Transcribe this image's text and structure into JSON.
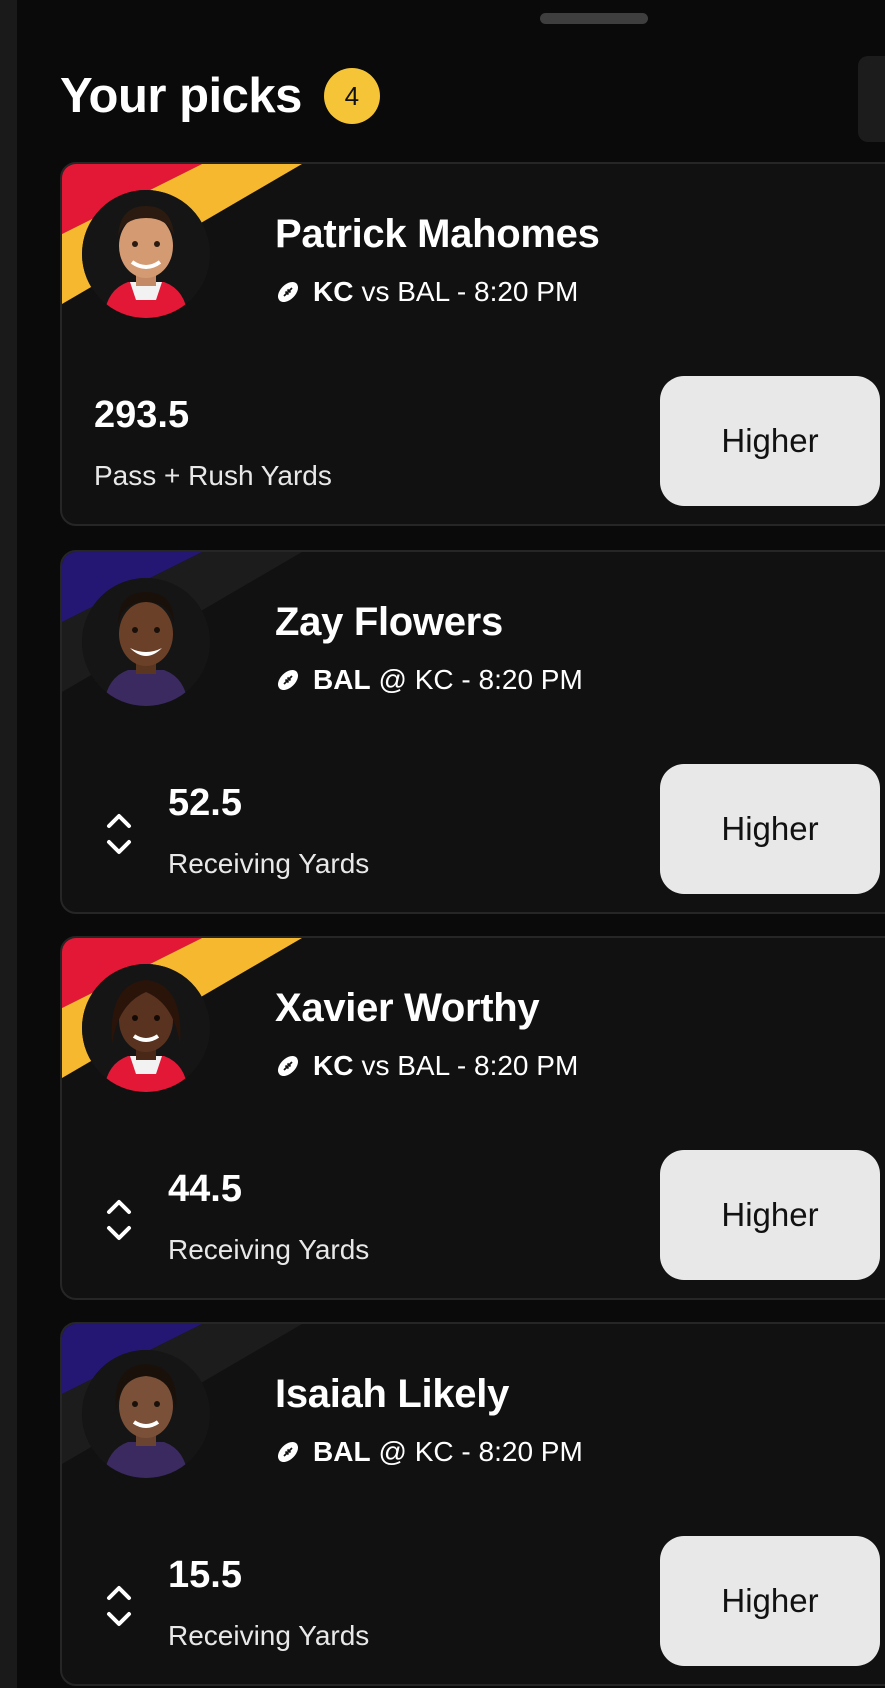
{
  "header": {
    "title": "Your picks",
    "pick_count": "4"
  },
  "picks": [
    {
      "player": "Patrick Mahomes",
      "team": "KC",
      "matchup_rest": "vs BAL - 8:20 PM",
      "line": "293.5",
      "stat": "Pass + Rush Yards",
      "button_label": "Higher",
      "team_colors": [
        "#e31837",
        "#f5b82e"
      ]
    },
    {
      "player": "Zay Flowers",
      "team": "BAL",
      "matchup_rest": "@ KC - 8:20 PM",
      "line": "52.5",
      "stat": "Receiving Yards",
      "button_label": "Higher",
      "team_colors": [
        "#241773",
        "#1a1a1a"
      ]
    },
    {
      "player": "Xavier Worthy",
      "team": "KC",
      "matchup_rest": "vs BAL - 8:20 PM",
      "line": "44.5",
      "stat": "Receiving Yards",
      "button_label": "Higher",
      "team_colors": [
        "#e31837",
        "#f5b82e"
      ]
    },
    {
      "player": "Isaiah Likely",
      "team": "BAL",
      "matchup_rest": "@ KC - 8:20 PM",
      "line": "15.5",
      "stat": "Receiving Yards",
      "button_label": "Higher",
      "team_colors": [
        "#241773",
        "#1a1a1a"
      ]
    }
  ]
}
